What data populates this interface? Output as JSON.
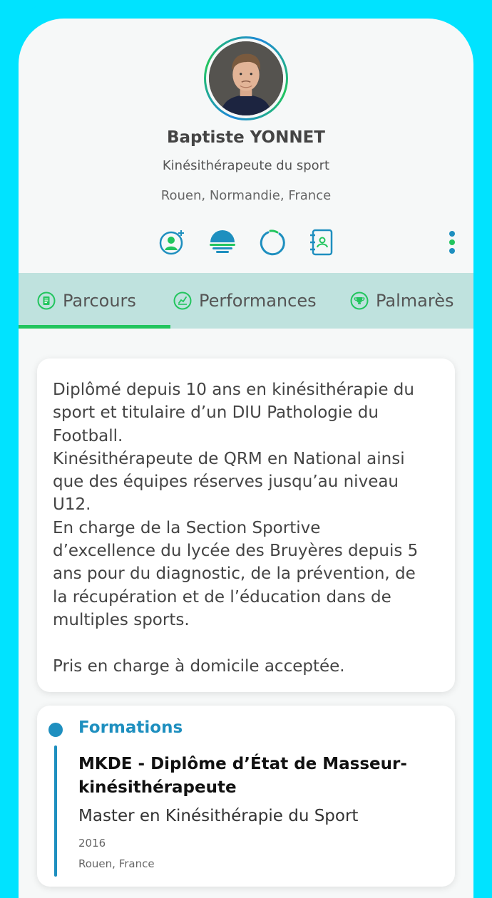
{
  "profile": {
    "name": "Baptiste YONNET",
    "title": "Kinésithérapeute du sport",
    "location": "Rouen, Normandie, France"
  },
  "actions": [
    {
      "icon": "add-contact-icon"
    },
    {
      "icon": "horizon-icon"
    },
    {
      "icon": "loading-circle-icon"
    },
    {
      "icon": "contact-book-icon"
    }
  ],
  "tabs": [
    {
      "label": "Parcours",
      "icon": "document-icon",
      "active": true
    },
    {
      "label": "Performances",
      "icon": "chart-icon",
      "active": false
    },
    {
      "label": "Palmarès",
      "icon": "trophy-icon",
      "active": false
    }
  ],
  "bio": "Diplômé depuis 10 ans en kinésithérapie du\nsport et titulaire d’un DIU Pathologie du\nFootball.\nKinésithérapeute de QRM en National ainsi\nque des équipes réserves jusqu’au niveau\nU12.\nEn charge de la Section Sportive\nd’excellence du lycée des Bruyères depuis 5\nans pour du diagnostic, de la prévention, de\nla récupération et de l’éducation dans de\nmultiples sports.\n\nPris en charge à domicile acceptée.",
  "formations": {
    "heading": "Formations",
    "degree": "MKDE - Diplôme d’État de Masseur-kinésithérapeute",
    "specialization": "Master en Kinésithérapie du Sport",
    "year": "2016",
    "place": "Rouen, France"
  },
  "colors": {
    "frame": "#00e3ff",
    "accent_green": "#22c55e",
    "accent_blue": "#1e8fbf",
    "tab_bar": "#bfe2de"
  }
}
